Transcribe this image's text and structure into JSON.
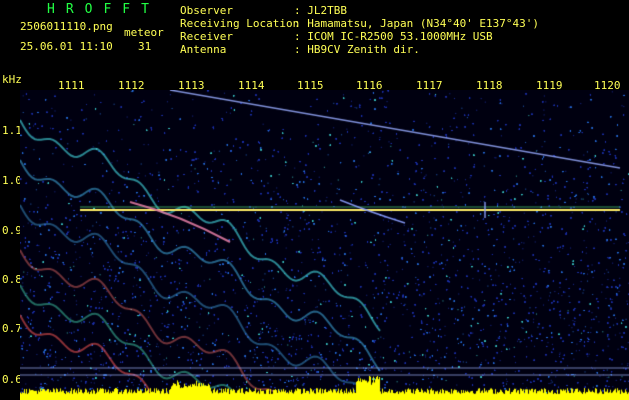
{
  "brand": "HROFFT",
  "file": {
    "name": "2506011110.png",
    "datetime": "25.06.01 11:10",
    "type_label": "meteor",
    "count": "31"
  },
  "info": {
    "labels": [
      "Observer",
      "Receiving Location",
      "Receiver",
      "Antenna"
    ],
    "values": [
      ": JL2TBB",
      ": Hamamatsu, Japan (N34°40' E137°43')",
      ": ICOM IC-R2500 53.1000MHz USB",
      ": HB9CV Zenith dir."
    ]
  },
  "axis": {
    "unit": "kHz",
    "x_ticks": [
      "1111",
      "1112",
      "1113",
      "1114",
      "1115",
      "1116",
      "1117",
      "1118",
      "1119",
      "1120"
    ],
    "y_ticks": [
      "1.1",
      "1.0",
      "0.9",
      "0.8",
      "0.7",
      "0.6"
    ]
  },
  "colors": {
    "background": "#000000",
    "text": "#ffff55",
    "brand": "#22ff44",
    "noise": "#1a2a8a",
    "signal_line": "#ffee66"
  }
}
